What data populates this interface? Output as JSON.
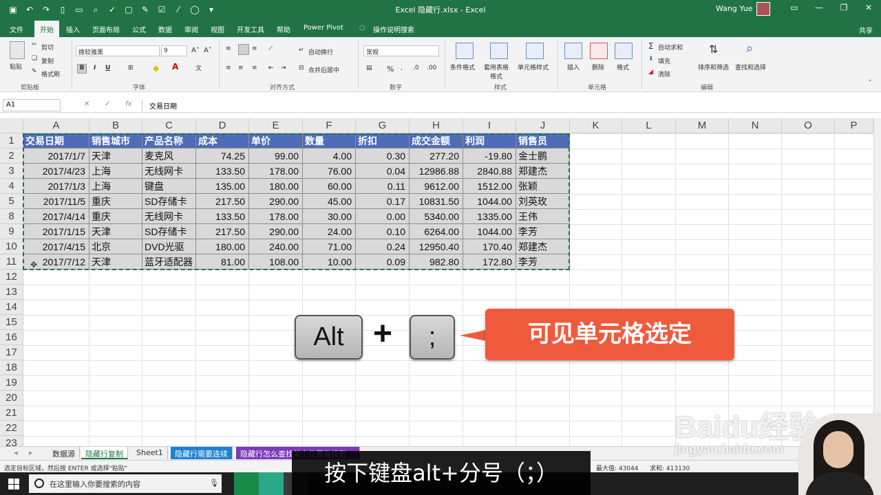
{
  "window": {
    "title": "Excel 隐藏行.xlsx - Excel",
    "user": "Wang Yue"
  },
  "tabs": [
    "文件",
    "开始",
    "插入",
    "页面布局",
    "公式",
    "数据",
    "审阅",
    "视图",
    "开发工具",
    "帮助",
    "Power Pivot",
    "操作说明搜索"
  ],
  "share": "共享",
  "ribbon": {
    "clipboard": {
      "paste": "粘贴",
      "cut": "剪切",
      "copy": "复制",
      "format_painter": "格式刷",
      "label": "剪贴板"
    },
    "font": {
      "name": "微软雅黑",
      "size": "9",
      "label": "字体",
      "bold": "B",
      "italic": "I",
      "underline": "U"
    },
    "align": {
      "wrap": "自动换行",
      "merge": "合并后居中",
      "label": "对齐方式"
    },
    "number": {
      "format": "常规",
      "label": "数字",
      "percent": "%"
    },
    "styles": {
      "cond": "条件格式",
      "table": "套用表格格式",
      "cell": "单元格样式",
      "label": "样式"
    },
    "cells": {
      "insert": "插入",
      "delete": "删除",
      "format": "格式",
      "label": "单元格"
    },
    "edit": {
      "autosum": "自动求和",
      "fill": "填充",
      "clear": "清除",
      "sort": "排序和筛选",
      "find": "查找和选择",
      "label": "编辑"
    }
  },
  "formula_bar": {
    "name_box": "A1",
    "fx": "fx",
    "content": "交易日期"
  },
  "columns": [
    "A",
    "B",
    "C",
    "D",
    "E",
    "F",
    "G",
    "H",
    "I",
    "J",
    "K",
    "L",
    "M",
    "N",
    "O",
    "P"
  ],
  "rows": [
    "1",
    "2",
    "3",
    "4",
    "5",
    "8",
    "9",
    "10",
    "11",
    "12",
    "13",
    "14",
    "15",
    "16",
    "17",
    "18",
    "19",
    "20",
    "21",
    "22",
    "23"
  ],
  "table": {
    "headers": [
      "交易日期",
      "销售城市",
      "产品名称",
      "成本",
      "单价",
      "数量",
      "折扣",
      "成交金额",
      "利润",
      "销售员"
    ],
    "rows": [
      [
        "2017/1/7",
        "天津",
        "麦克风",
        "74.25",
        "99.00",
        "4.00",
        "0.30",
        "277.20",
        "-19.80",
        "金士鹏"
      ],
      [
        "2017/4/23",
        "上海",
        "无线网卡",
        "133.50",
        "178.00",
        "76.00",
        "0.04",
        "12986.88",
        "2840.88",
        "郑建杰"
      ],
      [
        "2017/1/3",
        "上海",
        "键盘",
        "135.00",
        "180.00",
        "60.00",
        "0.11",
        "9612.00",
        "1512.00",
        "张颖"
      ],
      [
        "2017/11/5",
        "重庆",
        "SD存储卡",
        "217.50",
        "290.00",
        "45.00",
        "0.17",
        "10831.50",
        "1044.00",
        "刘英玫"
      ],
      [
        "2017/4/14",
        "重庆",
        "无线网卡",
        "133.50",
        "178.00",
        "30.00",
        "0.00",
        "5340.00",
        "1335.00",
        "王伟"
      ],
      [
        "2017/1/15",
        "天津",
        "SD存储卡",
        "217.50",
        "290.00",
        "24.00",
        "0.10",
        "6264.00",
        "1044.00",
        "李芳"
      ],
      [
        "2017/4/15",
        "北京",
        "DVD光驱",
        "180.00",
        "240.00",
        "71.00",
        "0.24",
        "12950.40",
        "170.40",
        "郑建杰"
      ],
      [
        "2017/7/12",
        "天津",
        "蓝牙适配器",
        "81.00",
        "108.00",
        "10.00",
        "0.09",
        "982.80",
        "172.80",
        "李芳"
      ]
    ]
  },
  "sheets": [
    "数据源",
    "隐藏行复制",
    "Sheet1",
    "隐藏行需要连续",
    "隐藏行怎么查找某个位置能找到"
  ],
  "status": {
    "left": "选定目标区域，然后按 ENTER 或选择\"粘贴\"",
    "max": "最大值: 43044",
    "sum": "求和: 413130"
  },
  "taskbar": {
    "search_placeholder": "在这里输入你要搜索的内容"
  },
  "overlay": {
    "key1": "Alt",
    "plus": "+",
    "key2": ";",
    "callout": "可见单元格选定",
    "subtitle": "按下键盘alt+分号（；）"
  },
  "watermark": {
    "brand": "Baidu经验",
    "url": "jingyan.baidu.com"
  },
  "colors": {
    "excel_green": "#217346",
    "header_blue": "#4f6cb8",
    "callout_red": "#f05a3c"
  }
}
